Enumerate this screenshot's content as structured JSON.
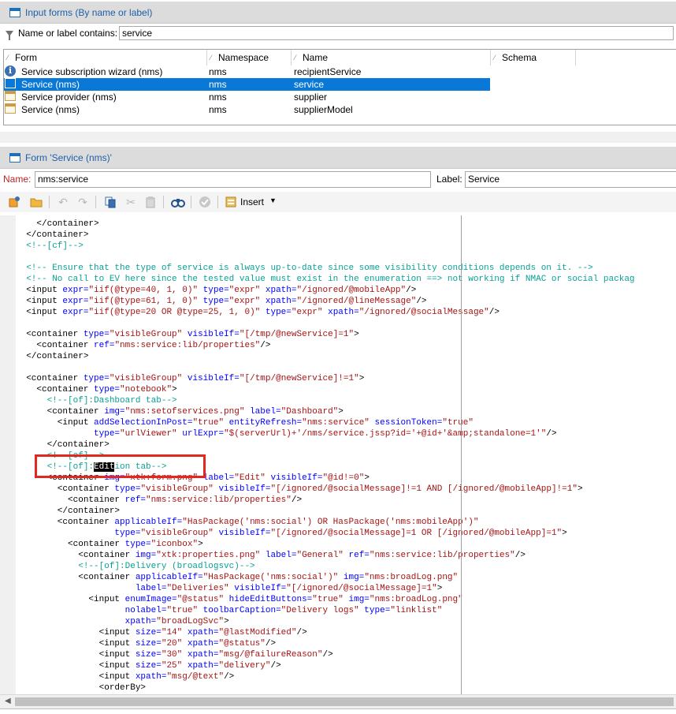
{
  "input_forms": {
    "title": "Input forms (By name or label)",
    "filter_label": "Name or label contains:",
    "filter_value": "service",
    "columns": [
      "Form",
      "Namespace",
      "Name",
      "Schema"
    ],
    "rows": [
      {
        "form": "Service subscription wizard (nms)",
        "namespace": "nms",
        "name": "recipientService",
        "schema": "",
        "icon": "info-icon",
        "selected": false
      },
      {
        "form": "Service (nms)",
        "namespace": "nms",
        "name": "service",
        "schema": "",
        "icon": "form-icon",
        "selected": true
      },
      {
        "form": "Service provider (nms)",
        "namespace": "nms",
        "name": "supplier",
        "schema": "",
        "icon": "form-icon",
        "selected": false
      },
      {
        "form": "Service (nms)",
        "namespace": "nms",
        "name": "supplierModel",
        "schema": "",
        "icon": "form-icon",
        "selected": false
      }
    ]
  },
  "form_detail": {
    "title": "Form 'Service (nms)'",
    "name_label": "Name:",
    "name_value": "nms:service",
    "label_label": "Label:",
    "label_value": "Service",
    "insert_label": "Insert",
    "toolbar_icons": [
      "new-icon",
      "open-folder-icon",
      "undo-icon",
      "redo-icon",
      "copy-icon",
      "cut-icon",
      "paste-icon",
      "find-icon",
      "check-icon",
      "insert-icon"
    ]
  },
  "colors": {
    "selection": "#0a78d7",
    "header_text": "#1f5fa8",
    "xml_tag": "#000000",
    "xml_attr": "#0000ff",
    "xml_value": "#a31515",
    "xml_comment": "#0aa094",
    "highlight_box": "#e0281f"
  },
  "code_lines": [
    [
      {
        "t": "t",
        "s": "    </container>"
      }
    ],
    [
      {
        "t": "t",
        "s": "  </container>"
      }
    ],
    [
      {
        "t": "c",
        "s": "  <!--[cf]-->"
      }
    ],
    [],
    [
      {
        "t": "c",
        "s": "  <!-- Ensure that the type of service is always up-to-date since some visibility conditions depends on it. -->"
      }
    ],
    [
      {
        "t": "c",
        "s": "  <!-- No call to EV here since the tested value must exist in the enumeration ==> not working if NMAC or social packag"
      }
    ],
    [
      {
        "t": "t",
        "s": "  <input "
      },
      {
        "t": "a",
        "s": "expr="
      },
      {
        "t": "v",
        "s": "\"iif(@type=40, 1, 0)\""
      },
      {
        "t": "a",
        "s": " type="
      },
      {
        "t": "v",
        "s": "\"expr\""
      },
      {
        "t": "a",
        "s": " xpath="
      },
      {
        "t": "v",
        "s": "\"/ignored/@mobileApp\""
      },
      {
        "t": "t",
        "s": "/>"
      }
    ],
    [
      {
        "t": "t",
        "s": "  <input "
      },
      {
        "t": "a",
        "s": "expr="
      },
      {
        "t": "v",
        "s": "\"iif(@type=61, 1, 0)\""
      },
      {
        "t": "a",
        "s": " type="
      },
      {
        "t": "v",
        "s": "\"expr\""
      },
      {
        "t": "a",
        "s": " xpath="
      },
      {
        "t": "v",
        "s": "\"/ignored/@lineMessage\""
      },
      {
        "t": "t",
        "s": "/>"
      }
    ],
    [
      {
        "t": "t",
        "s": "  <input "
      },
      {
        "t": "a",
        "s": "expr="
      },
      {
        "t": "v",
        "s": "\"iif(@type=20 OR @type=25, 1, 0)\""
      },
      {
        "t": "a",
        "s": " type="
      },
      {
        "t": "v",
        "s": "\"expr\""
      },
      {
        "t": "a",
        "s": " xpath="
      },
      {
        "t": "v",
        "s": "\"/ignored/@socialMessage\""
      },
      {
        "t": "t",
        "s": "/>"
      }
    ],
    [],
    [
      {
        "t": "t",
        "s": "  <container "
      },
      {
        "t": "a",
        "s": "type="
      },
      {
        "t": "v",
        "s": "\"visibleGroup\""
      },
      {
        "t": "a",
        "s": " visibleIf="
      },
      {
        "t": "v",
        "s": "\"[/tmp/@newService]=1\""
      },
      {
        "t": "t",
        "s": ">"
      }
    ],
    [
      {
        "t": "t",
        "s": "    <container "
      },
      {
        "t": "a",
        "s": "ref="
      },
      {
        "t": "v",
        "s": "\"nms:service:lib/properties\""
      },
      {
        "t": "t",
        "s": "/>"
      }
    ],
    [
      {
        "t": "t",
        "s": "  </container>"
      }
    ],
    [],
    [
      {
        "t": "t",
        "s": "  <container "
      },
      {
        "t": "a",
        "s": "type="
      },
      {
        "t": "v",
        "s": "\"visibleGroup\""
      },
      {
        "t": "a",
        "s": " visibleIf="
      },
      {
        "t": "v",
        "s": "\"[/tmp/@newService]!=1\""
      },
      {
        "t": "t",
        "s": ">"
      }
    ],
    [
      {
        "t": "t",
        "s": "    <container "
      },
      {
        "t": "a",
        "s": "type="
      },
      {
        "t": "v",
        "s": "\"notebook\""
      },
      {
        "t": "t",
        "s": ">"
      }
    ],
    [
      {
        "t": "c",
        "s": "      <!--[of]:Dashboard tab-->"
      }
    ],
    [
      {
        "t": "t",
        "s": "      <container "
      },
      {
        "t": "a",
        "s": "img="
      },
      {
        "t": "v",
        "s": "\"nms:setofservices.png\""
      },
      {
        "t": "a",
        "s": " label="
      },
      {
        "t": "v",
        "s": "\"Dashboard\""
      },
      {
        "t": "t",
        "s": ">"
      }
    ],
    [
      {
        "t": "t",
        "s": "        <input "
      },
      {
        "t": "a",
        "s": "addSelectionInPost="
      },
      {
        "t": "v",
        "s": "\"true\""
      },
      {
        "t": "a",
        "s": " entityRefresh="
      },
      {
        "t": "v",
        "s": "\"nms:service\""
      },
      {
        "t": "a",
        "s": " sessionToken="
      },
      {
        "t": "v",
        "s": "\"true\""
      }
    ],
    [
      {
        "t": "a",
        "s": "               type="
      },
      {
        "t": "v",
        "s": "\"urlViewer\""
      },
      {
        "t": "a",
        "s": " urlExpr="
      },
      {
        "t": "v",
        "s": "\"$(serverUrl)+'/nms/service.jssp?id='+@id+'&amp;standalone=1'\""
      },
      {
        "t": "t",
        "s": "/>"
      }
    ],
    [
      {
        "t": "t",
        "s": "      </container>"
      }
    ],
    [
      {
        "t": "c",
        "s": "      <!--[cf]-->"
      }
    ],
    [
      {
        "t": "c",
        "s": "      <!--[of]:"
      },
      {
        "t": "hl",
        "s": "Edit"
      },
      {
        "t": "c",
        "s": "ion tab-->"
      }
    ],
    [
      {
        "t": "t",
        "s": "      <container "
      },
      {
        "t": "a",
        "s": "img="
      },
      {
        "t": "v",
        "s": "\"xtk:form.png\""
      },
      {
        "t": "a",
        "s": " label="
      },
      {
        "t": "v",
        "s": "\"Edit\""
      },
      {
        "t": "a",
        "s": " visibleIf="
      },
      {
        "t": "v",
        "s": "\"@id!=0\""
      },
      {
        "t": "t",
        "s": ">"
      }
    ],
    [
      {
        "t": "t",
        "s": "        <container "
      },
      {
        "t": "a",
        "s": "type="
      },
      {
        "t": "v",
        "s": "\"visibleGroup\""
      },
      {
        "t": "a",
        "s": " visibleIf="
      },
      {
        "t": "v",
        "s": "\"[/ignored/@socialMessage]!=1 AND [/ignored/@mobileApp]!=1\""
      },
      {
        "t": "t",
        "s": ">"
      }
    ],
    [
      {
        "t": "t",
        "s": "          <container "
      },
      {
        "t": "a",
        "s": "ref="
      },
      {
        "t": "v",
        "s": "\"nms:service:lib/properties\""
      },
      {
        "t": "t",
        "s": "/>"
      }
    ],
    [
      {
        "t": "t",
        "s": "        </container>"
      }
    ],
    [
      {
        "t": "t",
        "s": "        <container "
      },
      {
        "t": "a",
        "s": "applicableIf="
      },
      {
        "t": "v",
        "s": "\"HasPackage('nms:social') OR HasPackage('nms:mobileApp')\""
      }
    ],
    [
      {
        "t": "a",
        "s": "                   type="
      },
      {
        "t": "v",
        "s": "\"visibleGroup\""
      },
      {
        "t": "a",
        "s": " visibleIf="
      },
      {
        "t": "v",
        "s": "\"[/ignored/@socialMessage]=1 OR [/ignored/@mobileApp]=1\""
      },
      {
        "t": "t",
        "s": ">"
      }
    ],
    [
      {
        "t": "t",
        "s": "          <container "
      },
      {
        "t": "a",
        "s": "type="
      },
      {
        "t": "v",
        "s": "\"iconbox\""
      },
      {
        "t": "t",
        "s": ">"
      }
    ],
    [
      {
        "t": "t",
        "s": "            <container "
      },
      {
        "t": "a",
        "s": "img="
      },
      {
        "t": "v",
        "s": "\"xtk:properties.png\""
      },
      {
        "t": "a",
        "s": " label="
      },
      {
        "t": "v",
        "s": "\"General\""
      },
      {
        "t": "a",
        "s": " ref="
      },
      {
        "t": "v",
        "s": "\"nms:service:lib/properties\""
      },
      {
        "t": "t",
        "s": "/>"
      }
    ],
    [
      {
        "t": "c",
        "s": "            <!--[of]:Delivery (broadlogsvc)-->"
      }
    ],
    [
      {
        "t": "t",
        "s": "            <container "
      },
      {
        "t": "a",
        "s": "applicableIf="
      },
      {
        "t": "v",
        "s": "\"HasPackage('nms:social')\""
      },
      {
        "t": "a",
        "s": " img="
      },
      {
        "t": "v",
        "s": "\"nms:broadLog.png\""
      }
    ],
    [
      {
        "t": "a",
        "s": "                       label="
      },
      {
        "t": "v",
        "s": "\"Deliveries\""
      },
      {
        "t": "a",
        "s": " visibleIf="
      },
      {
        "t": "v",
        "s": "\"[/ignored/@socialMessage]=1\""
      },
      {
        "t": "t",
        "s": ">"
      }
    ],
    [
      {
        "t": "t",
        "s": "              <input "
      },
      {
        "t": "a",
        "s": "enumImage="
      },
      {
        "t": "v",
        "s": "\"@status\""
      },
      {
        "t": "a",
        "s": " hideEditButtons="
      },
      {
        "t": "v",
        "s": "\"true\""
      },
      {
        "t": "a",
        "s": " img="
      },
      {
        "t": "v",
        "s": "\"nms:broadLog.png\""
      }
    ],
    [
      {
        "t": "a",
        "s": "                     nolabel="
      },
      {
        "t": "v",
        "s": "\"true\""
      },
      {
        "t": "a",
        "s": " toolbarCaption="
      },
      {
        "t": "v",
        "s": "\"Delivery logs\""
      },
      {
        "t": "a",
        "s": " type="
      },
      {
        "t": "v",
        "s": "\"linklist\""
      }
    ],
    [
      {
        "t": "a",
        "s": "                     xpath="
      },
      {
        "t": "v",
        "s": "\"broadLogSvc\""
      },
      {
        "t": "t",
        "s": ">"
      }
    ],
    [
      {
        "t": "t",
        "s": "                <input "
      },
      {
        "t": "a",
        "s": "size="
      },
      {
        "t": "v",
        "s": "\"14\""
      },
      {
        "t": "a",
        "s": " xpath="
      },
      {
        "t": "v",
        "s": "\"@lastModified\""
      },
      {
        "t": "t",
        "s": "/>"
      }
    ],
    [
      {
        "t": "t",
        "s": "                <input "
      },
      {
        "t": "a",
        "s": "size="
      },
      {
        "t": "v",
        "s": "\"20\""
      },
      {
        "t": "a",
        "s": " xpath="
      },
      {
        "t": "v",
        "s": "\"@status\""
      },
      {
        "t": "t",
        "s": "/>"
      }
    ],
    [
      {
        "t": "t",
        "s": "                <input "
      },
      {
        "t": "a",
        "s": "size="
      },
      {
        "t": "v",
        "s": "\"30\""
      },
      {
        "t": "a",
        "s": " xpath="
      },
      {
        "t": "v",
        "s": "\"msg/@failureReason\""
      },
      {
        "t": "t",
        "s": "/>"
      }
    ],
    [
      {
        "t": "t",
        "s": "                <input "
      },
      {
        "t": "a",
        "s": "size="
      },
      {
        "t": "v",
        "s": "\"25\""
      },
      {
        "t": "a",
        "s": " xpath="
      },
      {
        "t": "v",
        "s": "\"delivery\""
      },
      {
        "t": "t",
        "s": "/>"
      }
    ],
    [
      {
        "t": "t",
        "s": "                <input "
      },
      {
        "t": "a",
        "s": "xpath="
      },
      {
        "t": "v",
        "s": "\"msg/@text\""
      },
      {
        "t": "t",
        "s": "/>"
      }
    ],
    [
      {
        "t": "t",
        "s": "                <orderBy>"
      }
    ]
  ]
}
